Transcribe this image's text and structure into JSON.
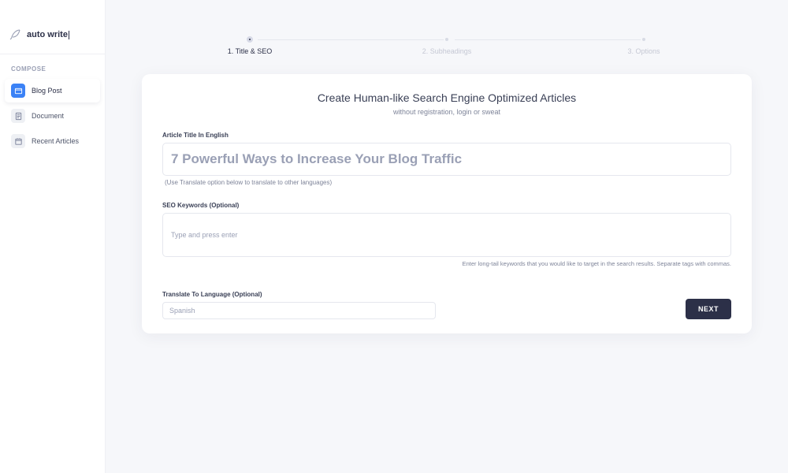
{
  "brand": {
    "name": "auto write"
  },
  "sidebar": {
    "section_label": "COMPOSE",
    "items": [
      {
        "label": "Blog Post",
        "active": true
      },
      {
        "label": "Document",
        "active": false
      },
      {
        "label": "Recent Articles",
        "active": false
      }
    ]
  },
  "stepper": {
    "steps": [
      {
        "label": "1. Title & SEO",
        "active": true
      },
      {
        "label": "2. Subheadings",
        "active": false
      },
      {
        "label": "3. Options",
        "active": false
      }
    ]
  },
  "card": {
    "title": "Create Human-like Search Engine Optimized Articles",
    "subtitle": "without registration, login or sweat"
  },
  "fields": {
    "title": {
      "label": "Article Title In English",
      "placeholder": "7 Powerful Ways to Increase Your Blog Traffic",
      "hint": "(Use Translate option below to translate to other languages)"
    },
    "keywords": {
      "label": "SEO Keywords (Optional)",
      "placeholder": "Type and press enter",
      "hint": "Enter long-tail keywords that you would like to target in the search results. Separate tags with commas."
    },
    "language": {
      "label": "Translate To Language (Optional)",
      "placeholder": "Spanish"
    }
  },
  "actions": {
    "next": "NEXT"
  }
}
